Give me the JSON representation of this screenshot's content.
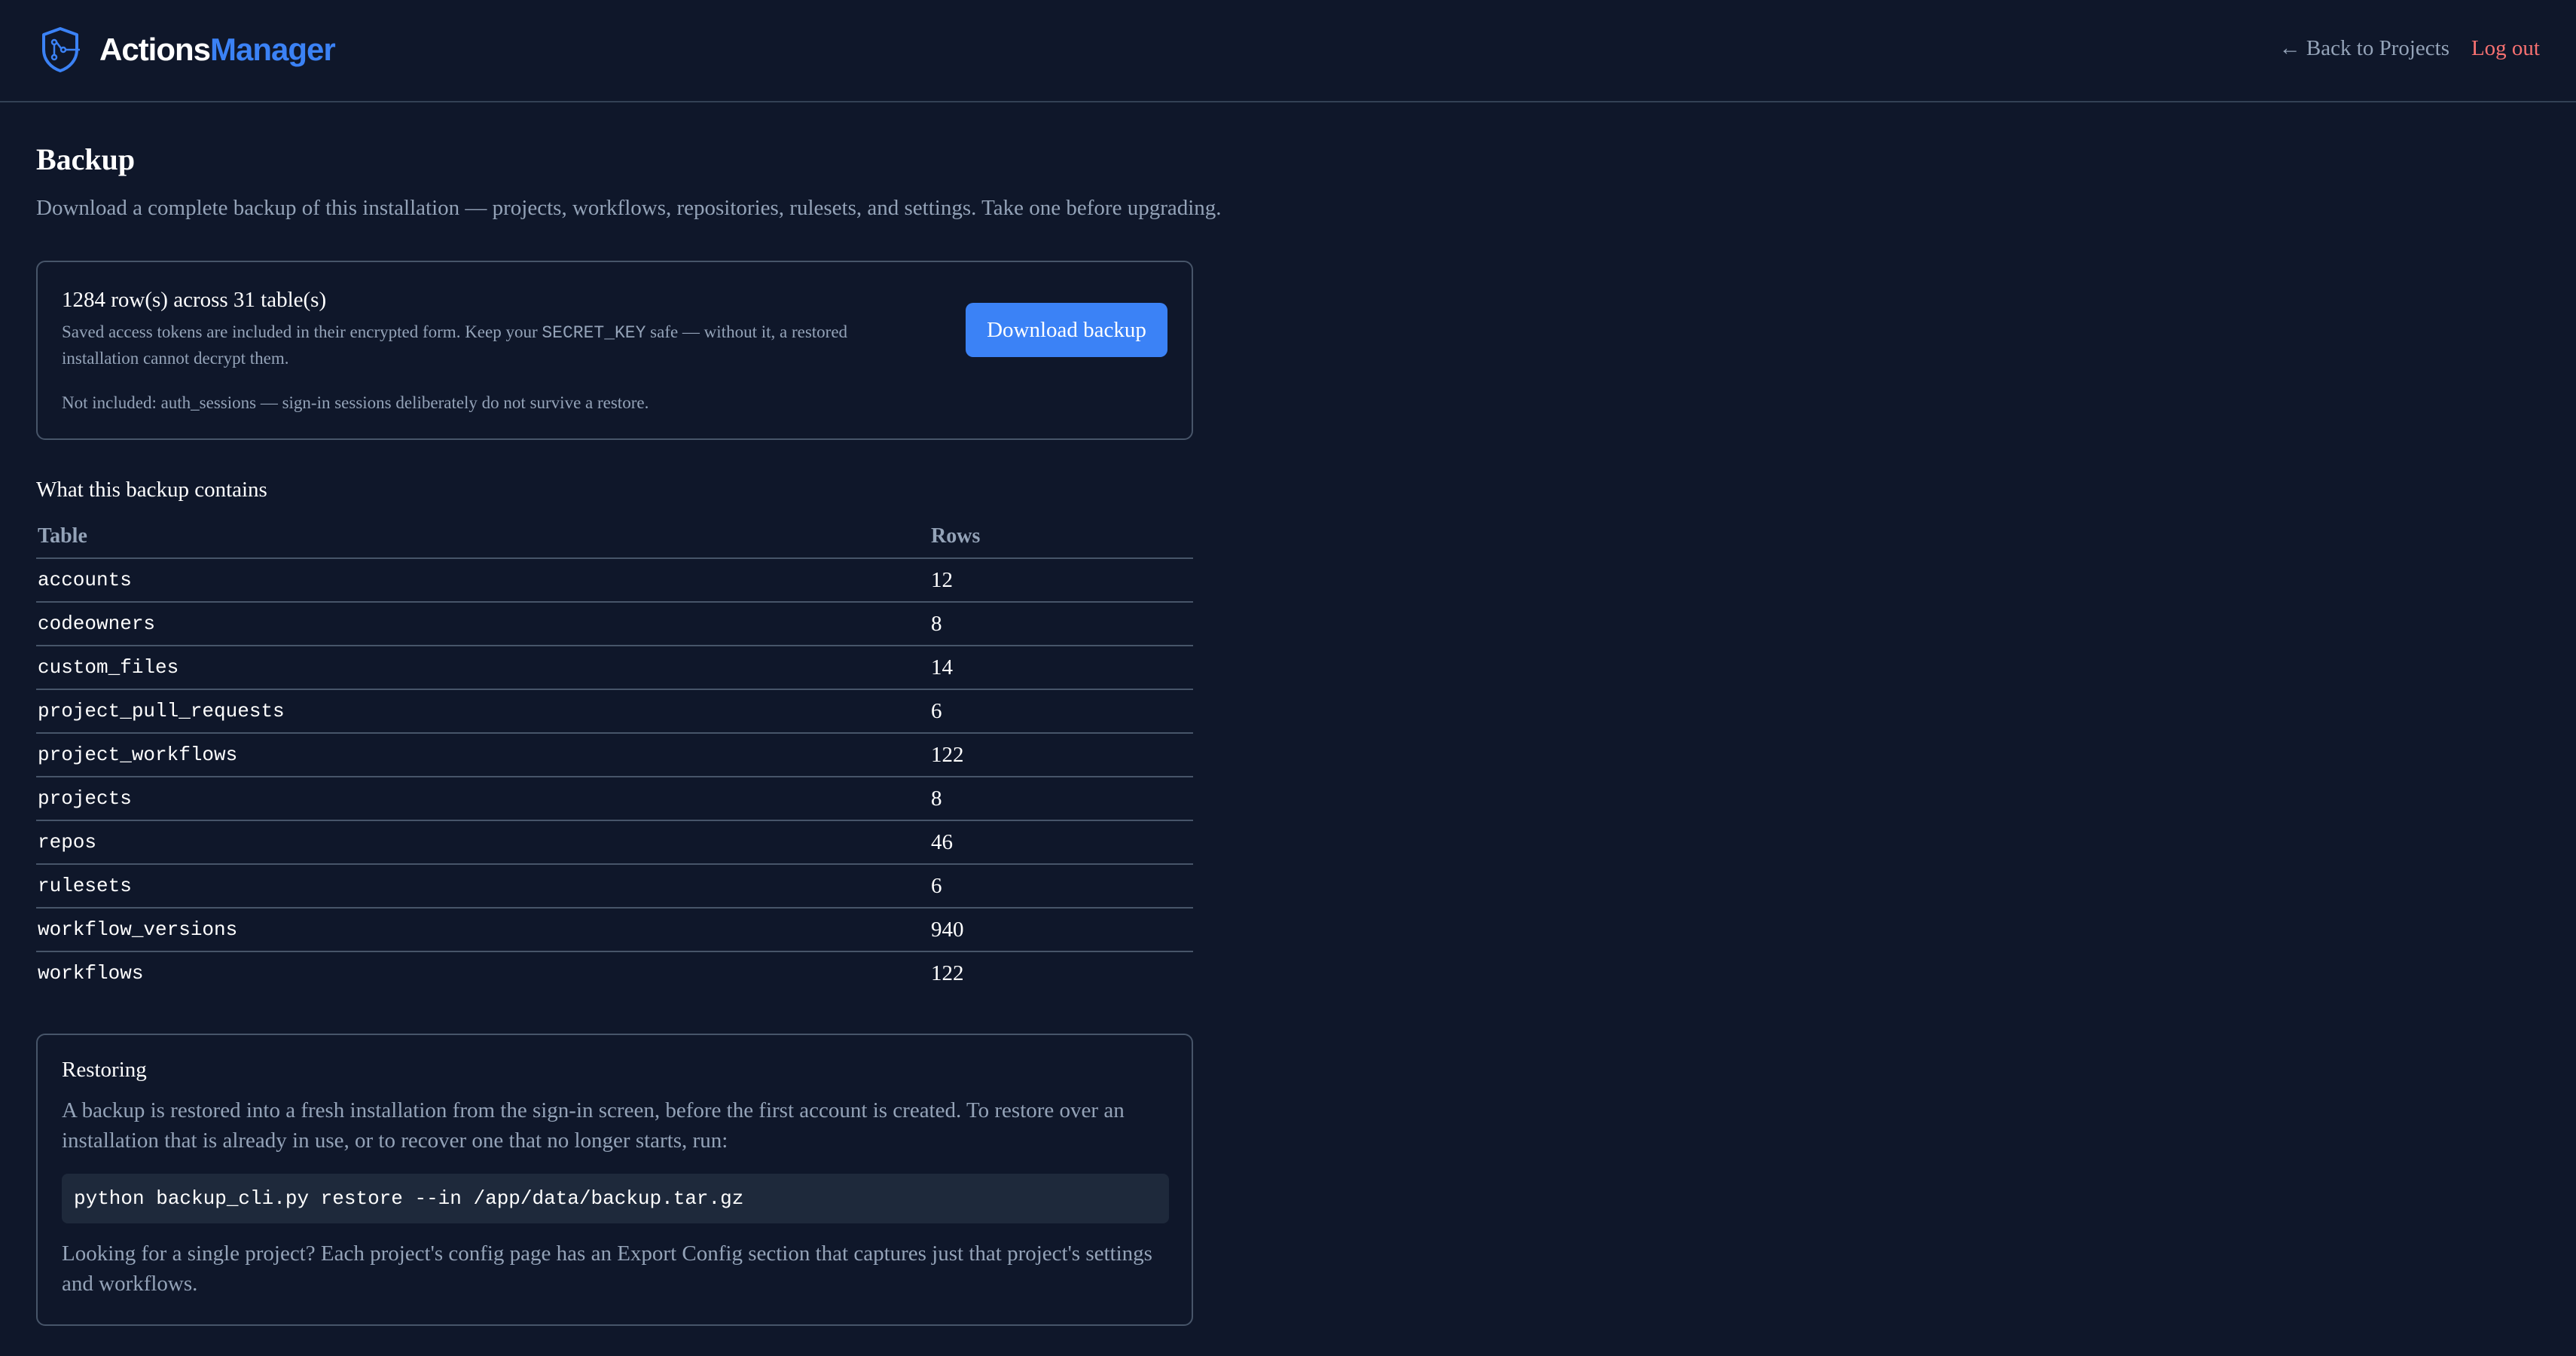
{
  "header": {
    "brand_part1": "Actions",
    "brand_part2": "Manager",
    "back_link": "← Back to Projects",
    "logout_link": "Log out"
  },
  "page": {
    "title": "Backup",
    "subtitle": "Download a complete backup of this installation — projects, workflows, repositories, rulesets, and settings. Take one before upgrading."
  },
  "summary_card": {
    "count": "1284 row(s) across 31 table(s)",
    "note_before": "Saved access tokens are included in their encrypted form. Keep your ",
    "note_code": "SECRET_KEY",
    "note_after": " safe — without it, a restored installation cannot decrypt them.",
    "excluded": "Not included: auth_sessions — sign-in sessions deliberately do not survive a restore.",
    "download_label": "Download backup"
  },
  "contents": {
    "heading": "What this backup contains",
    "columns": [
      "Table",
      "Rows"
    ],
    "rows": [
      {
        "name": "accounts",
        "rows": "12"
      },
      {
        "name": "codeowners",
        "rows": "8"
      },
      {
        "name": "custom_files",
        "rows": "14"
      },
      {
        "name": "project_pull_requests",
        "rows": "6"
      },
      {
        "name": "project_workflows",
        "rows": "122"
      },
      {
        "name": "projects",
        "rows": "8"
      },
      {
        "name": "repos",
        "rows": "46"
      },
      {
        "name": "rulesets",
        "rows": "6"
      },
      {
        "name": "workflow_versions",
        "rows": "940"
      },
      {
        "name": "workflows",
        "rows": "122"
      }
    ]
  },
  "restoring": {
    "title": "Restoring",
    "paragraph1": "A backup is restored into a fresh installation from the sign-in screen, before the first account is created. To restore over an installation that is already in use, or to recover one that no longer starts, run:",
    "command": "python backup_cli.py restore --in /app/data/backup.tar.gz",
    "paragraph2": "Looking for a single project? Each project's config page has an Export Config section that captures just that project's settings and workflows."
  },
  "colors": {
    "background": "#0f172a",
    "accent": "#3b82f6",
    "danger": "#f87171",
    "muted": "#94a3b8"
  },
  "icons": {
    "logo": "shield-workflow-icon"
  }
}
